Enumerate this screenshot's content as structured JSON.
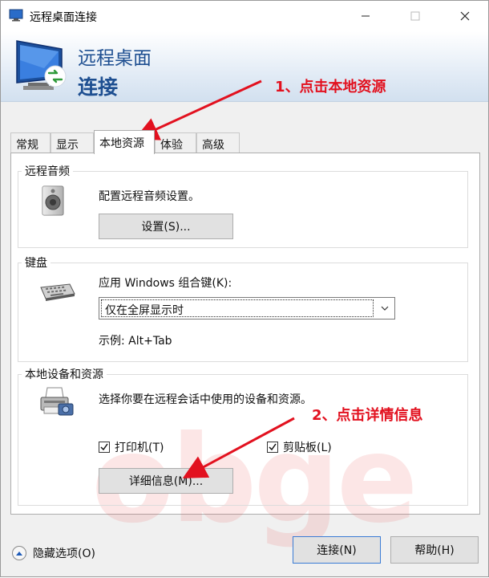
{
  "window": {
    "title": "远程桌面连接",
    "min_icon": "minimize-icon",
    "max_icon": "maximize-icon",
    "close_icon": "close-icon"
  },
  "banner": {
    "line1": "远程桌面",
    "line2": "连接",
    "logo_icon": "remote-desktop-icon"
  },
  "annotations": {
    "step1": "1、点击本地资源",
    "step2": "2、点击详情信息",
    "color": "#e2111f"
  },
  "tabs": [
    {
      "label": "常规",
      "active": false
    },
    {
      "label": "显示",
      "active": false
    },
    {
      "label": "本地资源",
      "active": true
    },
    {
      "label": "体验",
      "active": false
    },
    {
      "label": "高级",
      "active": false
    }
  ],
  "remote_audio": {
    "title": "远程音频",
    "description": "配置远程音频设置。",
    "button_label": "设置(S)...",
    "icon": "speaker-icon"
  },
  "keyboard": {
    "title": "键盘",
    "description": "应用 Windows 组合键(K):",
    "selected_option": "仅在全屏显示时",
    "example": "示例: Alt+Tab",
    "icon": "keyboard-icon"
  },
  "local_devices": {
    "title": "本地设备和资源",
    "description": "选择你要在远程会话中使用的设备和资源。",
    "printers_label": "打印机(T)",
    "printers_checked": true,
    "clipboard_label": "剪贴板(L)",
    "clipboard_checked": true,
    "details_button_label": "详细信息(M)...",
    "icon": "printer-icon"
  },
  "footer": {
    "hide_options_label": "隐藏选项(O)",
    "connect_label": "连接(N)",
    "help_label": "帮助(H)"
  },
  "watermark": "obge"
}
